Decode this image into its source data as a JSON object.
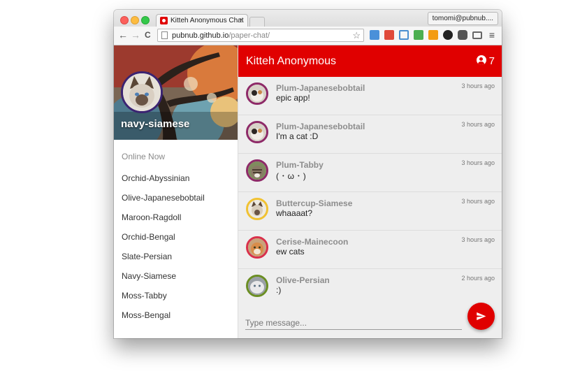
{
  "browser": {
    "tab_title": "Kitteh Anonymous Chat",
    "tab_close": "×",
    "profile_name": "tomomi@pubnub....",
    "url_host": "pubnub.github.io",
    "url_path": "/paper-chat/",
    "back": "←",
    "forward": "→",
    "reload": "C",
    "star": "☆",
    "menu": "≡"
  },
  "sidebar": {
    "username": "navy-siamese",
    "online_label": "Online Now",
    "online_users": [
      "Orchid-Abyssinian",
      "Olive-Japanesebobtail",
      "Maroon-Ragdoll",
      "Orchid-Bengal",
      "Slate-Persian",
      "Navy-Siamese",
      "Moss-Tabby",
      "Moss-Bengal"
    ]
  },
  "chat": {
    "room_title": "Kitteh Anonymous",
    "online_count": "7",
    "messages": [
      {
        "user": "Plum-Japanesebobtail",
        "text": "epic app!",
        "time": "3 hours ago",
        "ring": "#8e2a68"
      },
      {
        "user": "Plum-Japanesebobtail",
        "text": "I'm a cat :D",
        "time": "3 hours ago",
        "ring": "#8e2a68"
      },
      {
        "user": "Plum-Tabby",
        "text": "( ･ ω ･ )",
        "time": "3 hours ago",
        "ring": "#8e2a68"
      },
      {
        "user": "Buttercup-Siamese",
        "text": "whaaaat?",
        "time": "3 hours ago",
        "ring": "#f1c232"
      },
      {
        "user": "Cerise-Mainecoon",
        "text": "ew cats",
        "time": "3 hours ago",
        "ring": "#d9304b"
      },
      {
        "user": "Olive-Persian",
        "text": ":)",
        "time": "2 hours ago",
        "ring": "#6b8e23"
      }
    ],
    "input_placeholder": "Type message..."
  },
  "colors": {
    "accent": "#e00000",
    "sidebar_avatar_ring": "#3b2472"
  }
}
